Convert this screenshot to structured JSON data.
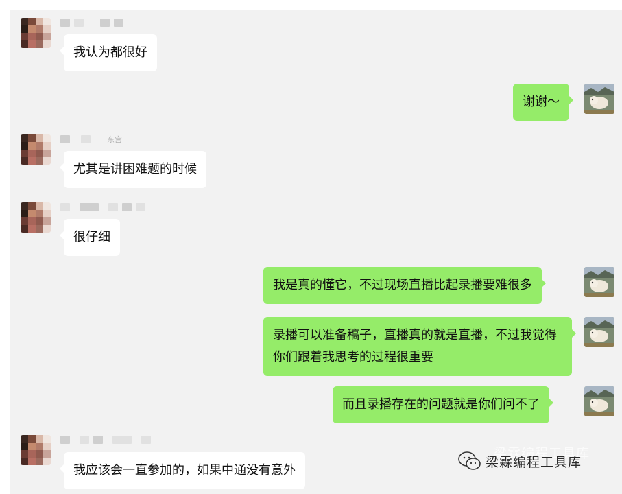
{
  "messages": [
    {
      "side": "other",
      "text": "我认为都很好"
    },
    {
      "side": "self",
      "text": "谢谢～"
    },
    {
      "side": "other",
      "name_suffix": "东宫",
      "text": "尤其是讲困难题的时候"
    },
    {
      "side": "other",
      "text": "很仔细"
    },
    {
      "side": "self",
      "text": "我是真的懂它，不过现场直播比起录播要难很多"
    },
    {
      "side": "self",
      "text": "录播可以准备稿子，直播真的就是直播，不过我觉得你们跟着我思考的过程很重要"
    },
    {
      "side": "self",
      "text": "而且录播存在的问题就是你们问不了"
    },
    {
      "side": "other",
      "text": "我应该会一直参加的，如果中通没有意外"
    }
  ],
  "watermark": {
    "icon": "wechat-icon",
    "text": "梁霖编程工具库"
  },
  "colors": {
    "chat_bg": "#f2f2f2",
    "self_bubble": "#95ec69",
    "other_bubble": "#ffffff"
  }
}
